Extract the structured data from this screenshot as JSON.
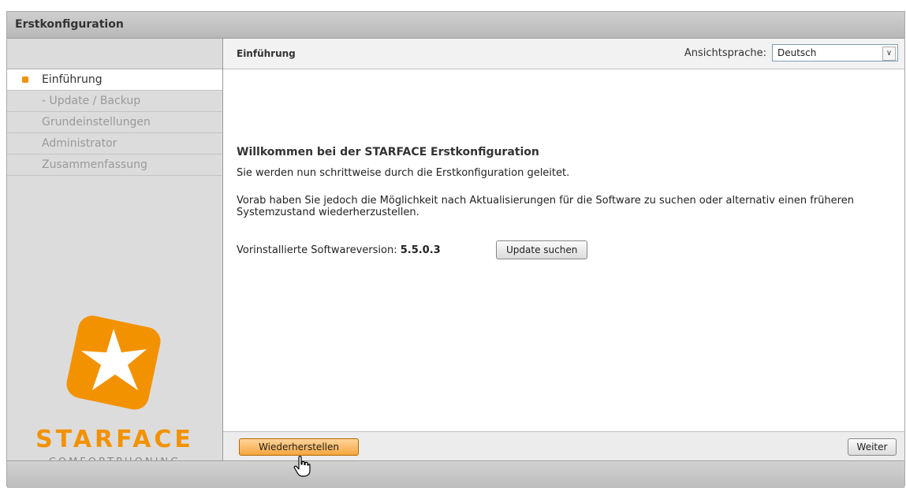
{
  "window": {
    "title": "Erstkonfiguration"
  },
  "sidebar": {
    "items": [
      {
        "label": "Einführung",
        "active": true
      },
      {
        "label": "- Update / Backup",
        "active": false
      },
      {
        "label": "Grundeinstellungen",
        "active": false
      },
      {
        "label": "Administrator",
        "active": false
      },
      {
        "label": "Zusammenfassung",
        "active": false
      }
    ],
    "brand": "STARFACE",
    "tagline": "COMFORTPHONING"
  },
  "header": {
    "title": "Einführung",
    "language_label": "Ansichtsprache:",
    "language_value": "Deutsch"
  },
  "content": {
    "welcome": "Willkommen bei der STARFACE Erstkonfiguration",
    "p1": "Sie werden nun schrittweise durch die Erstkonfiguration geleitet.",
    "p2": "Vorab haben Sie jedoch die Möglichkeit nach Aktualisierungen für die Software zu suchen oder alternativ einen früheren Systemzustand wiederherzustellen.",
    "version_label": "Vorinstallierte Softwareversion: ",
    "version_value": "5.5.0.3",
    "update_button": "Update suchen"
  },
  "footer": {
    "restore_button": "Wiederherstellen",
    "next_button": "Weiter"
  },
  "colors": {
    "accent": "#f39200"
  }
}
